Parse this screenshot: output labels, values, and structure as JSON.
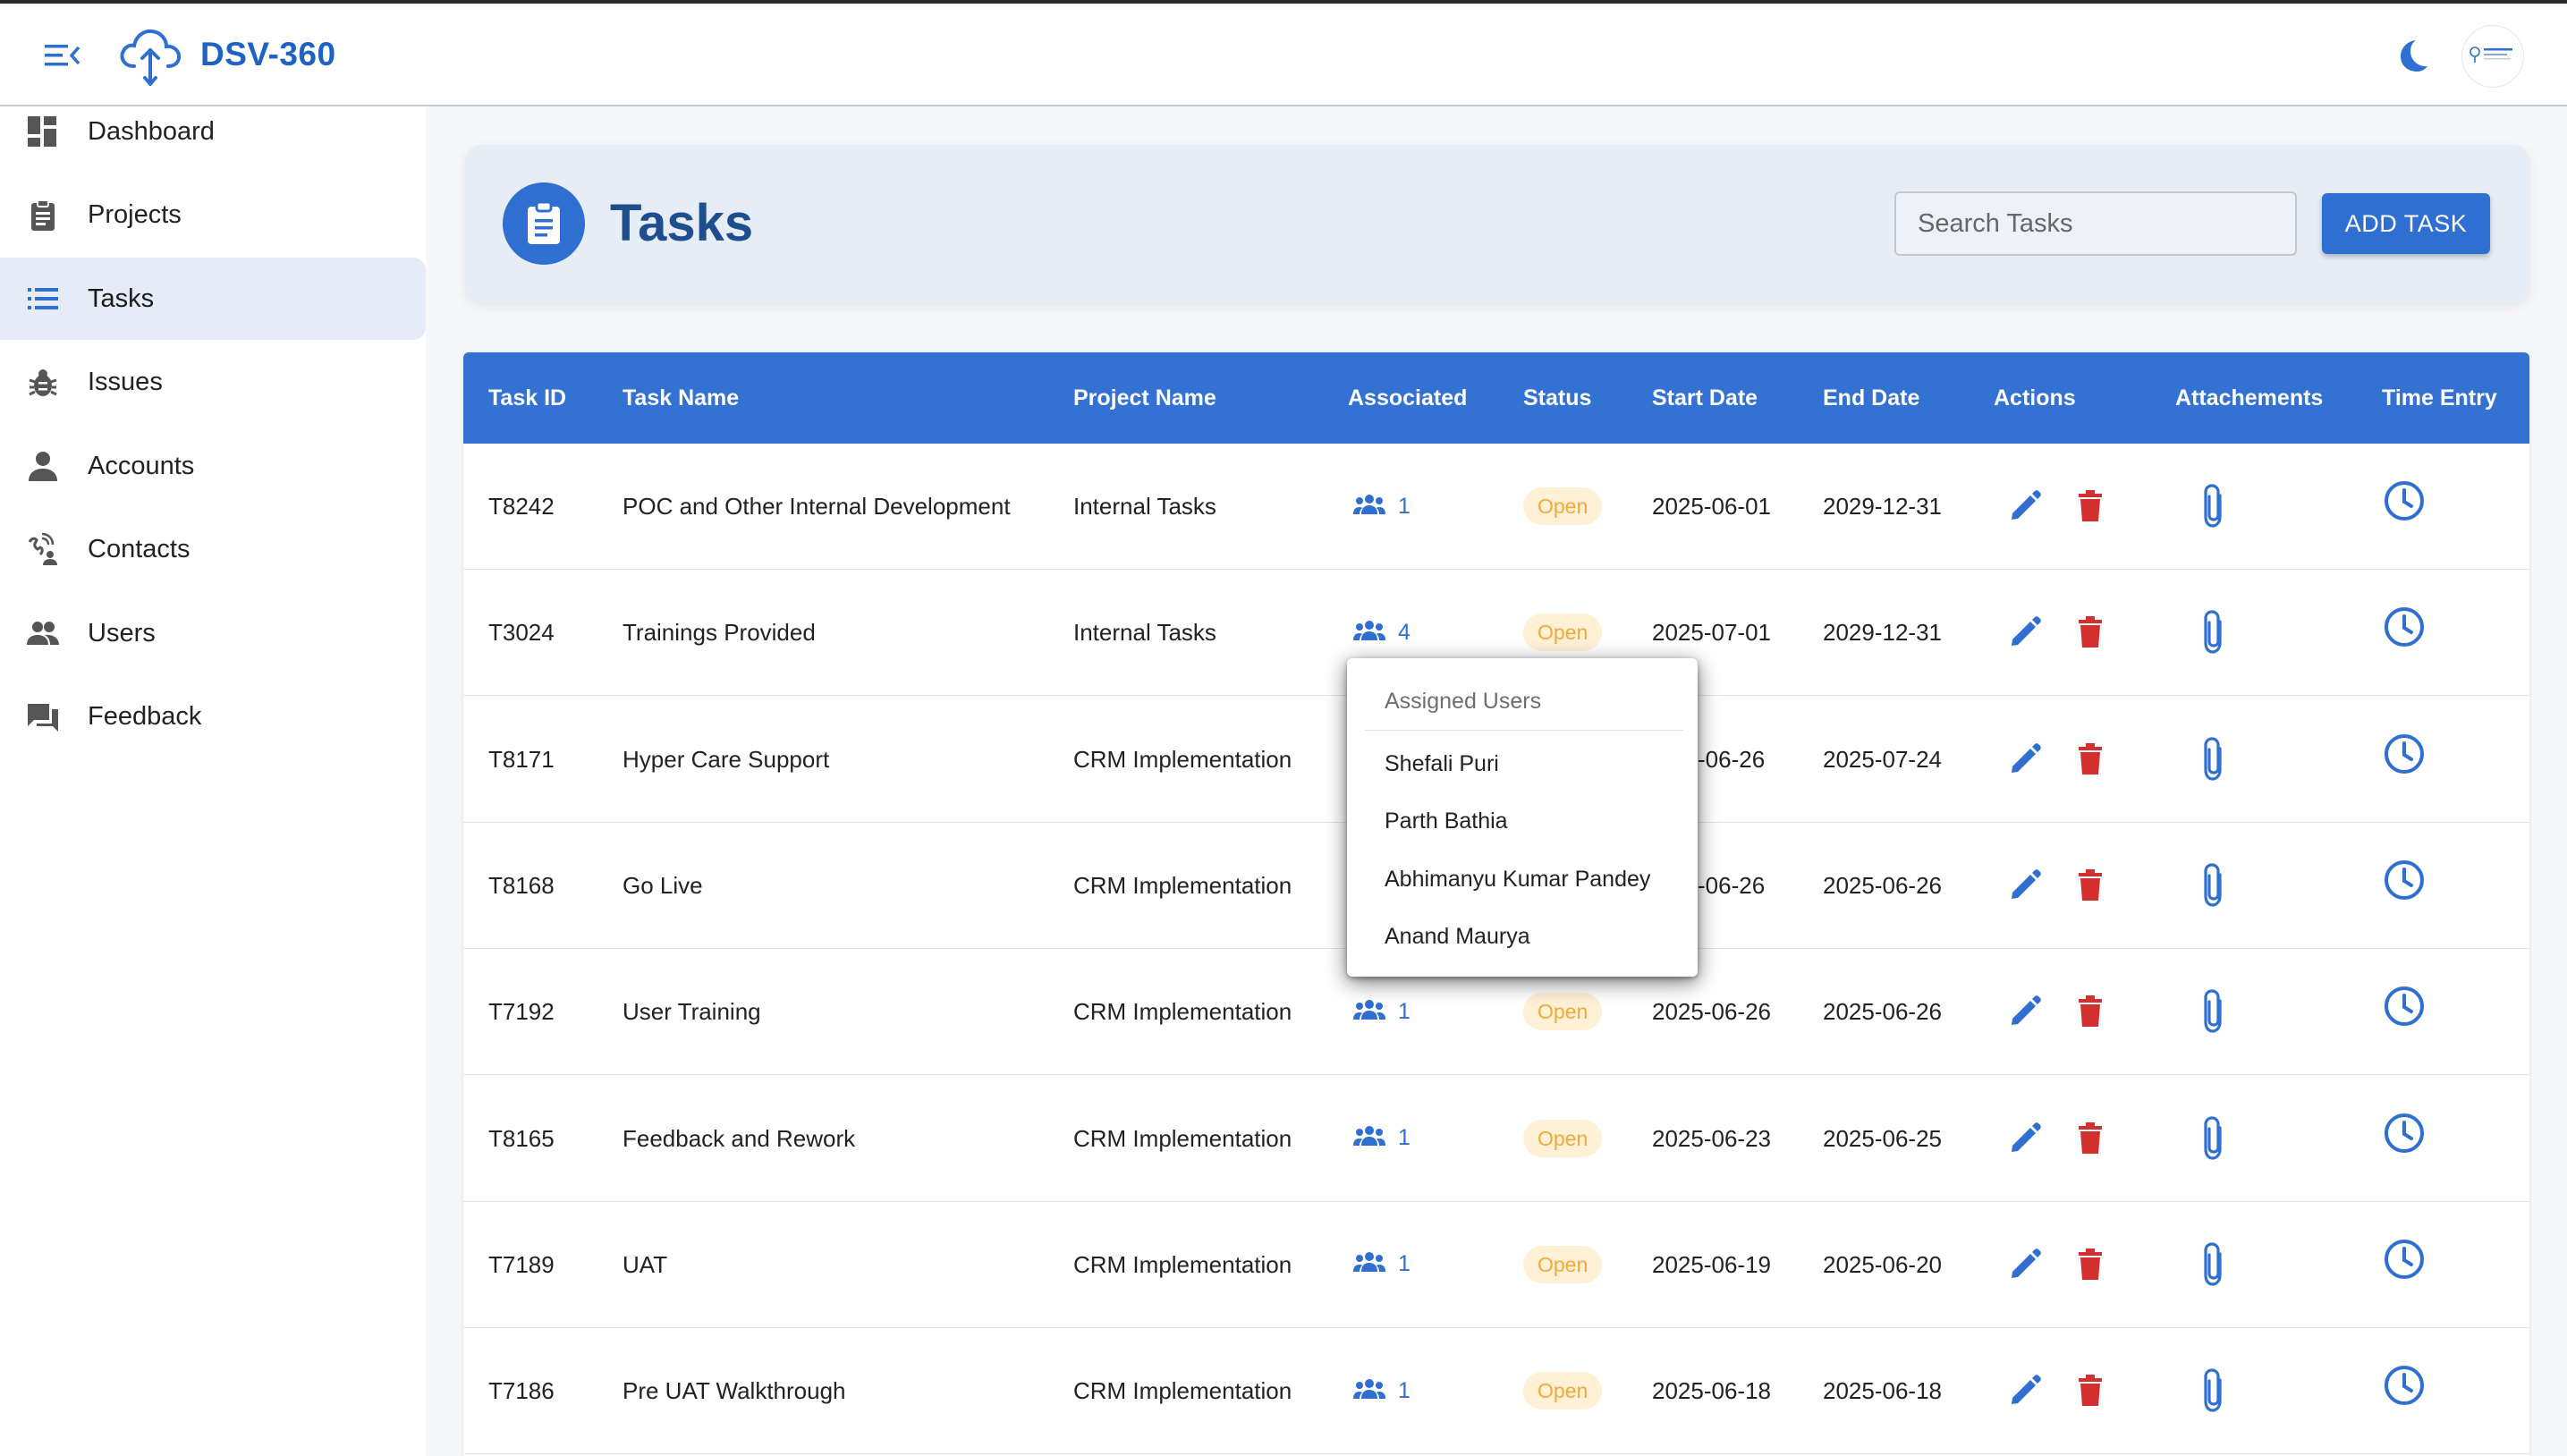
{
  "app": {
    "name": "DSV-360"
  },
  "sidebar": {
    "items": [
      {
        "label": "Dashboard",
        "icon": "dashboard-icon"
      },
      {
        "label": "Projects",
        "icon": "clipboard-icon"
      },
      {
        "label": "Tasks",
        "icon": "list-icon",
        "active": true
      },
      {
        "label": "Issues",
        "icon": "bug-icon"
      },
      {
        "label": "Accounts",
        "icon": "person-icon"
      },
      {
        "label": "Contacts",
        "icon": "contacts-icon"
      },
      {
        "label": "Users",
        "icon": "group-icon"
      },
      {
        "label": "Feedback",
        "icon": "chat-icon"
      }
    ]
  },
  "page": {
    "title": "Tasks",
    "search_placeholder": "Search Tasks",
    "add_button": "ADD TASK"
  },
  "table": {
    "columns": [
      "Task ID",
      "Task Name",
      "Project Name",
      "Associated",
      "Status",
      "Start Date",
      "End Date",
      "Actions",
      "Attachements",
      "Time Entry"
    ],
    "rows": [
      {
        "id": "T8242",
        "name": "POC and Other Internal Development",
        "project": "Internal Tasks",
        "associated": "1",
        "status": "Open",
        "start": "2025-06-01",
        "end": "2029-12-31"
      },
      {
        "id": "T3024",
        "name": "Trainings Provided",
        "project": "Internal Tasks",
        "associated": "4",
        "status": "Open",
        "start": "2025-07-01",
        "end": "2029-12-31"
      },
      {
        "id": "T8171",
        "name": "Hyper Care Support",
        "project": "CRM Implementation",
        "associated": "",
        "status": "",
        "start": "-06-26",
        "end": "2025-07-24"
      },
      {
        "id": "T8168",
        "name": "Go Live",
        "project": "CRM Implementation",
        "associated": "",
        "status": "",
        "start": "-06-26",
        "end": "2025-06-26"
      },
      {
        "id": "T7192",
        "name": "User Training",
        "project": "CRM Implementation",
        "associated": "1",
        "status": "Open",
        "start": "2025-06-26",
        "end": "2025-06-26"
      },
      {
        "id": "T8165",
        "name": "Feedback and Rework",
        "project": "CRM Implementation",
        "associated": "1",
        "status": "Open",
        "start": "2025-06-23",
        "end": "2025-06-25"
      },
      {
        "id": "T7189",
        "name": "UAT",
        "project": "CRM Implementation",
        "associated": "1",
        "status": "Open",
        "start": "2025-06-19",
        "end": "2025-06-20"
      },
      {
        "id": "T7186",
        "name": "Pre UAT Walkthrough",
        "project": "CRM Implementation",
        "associated": "1",
        "status": "Open",
        "start": "2025-06-18",
        "end": "2025-06-18"
      }
    ]
  },
  "popup": {
    "title": "Assigned Users",
    "users": [
      "Shefali Puri",
      "Parth Bathia",
      "Abhimanyu Kumar Pandey",
      "Anand Maurya"
    ]
  },
  "colors": {
    "accent": "#2f6fd1",
    "header_blue": "#3371d2",
    "delete_red": "#d32f2f",
    "badge_bg": "#fff1d6",
    "badge_text": "#f0a93b"
  },
  "icons": {
    "menu": "menu-collapse-icon",
    "brand": "cloud-upload-icon",
    "theme": "moon-icon",
    "edit": "pencil-icon",
    "delete": "trash-icon",
    "attach": "paperclip-icon",
    "time": "clock-icon",
    "associated": "people-icon"
  }
}
